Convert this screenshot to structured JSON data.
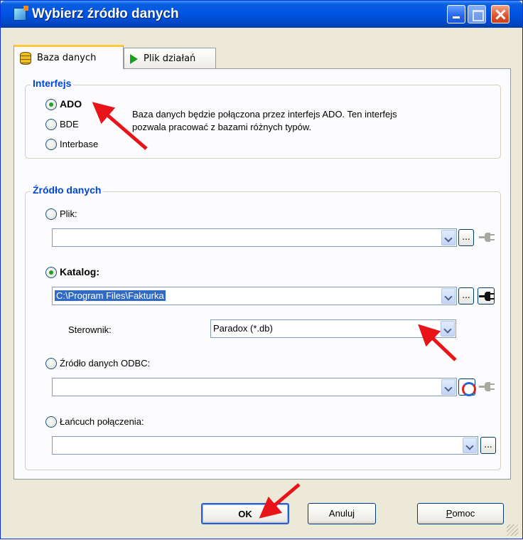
{
  "window": {
    "title": "Wybierz źródło danych",
    "controls": [
      "minimize-icon",
      "maximize-icon",
      "close-icon"
    ]
  },
  "tabs": [
    {
      "label": "Baza danych",
      "icon": "database-icon",
      "active": true
    },
    {
      "label": "Plik działań",
      "icon": "play-icon",
      "active": false
    }
  ],
  "interface_group": {
    "title": "Interfejs",
    "options": [
      {
        "label": "ADO",
        "checked": true
      },
      {
        "label": "BDE",
        "checked": false
      },
      {
        "label": "Interbase",
        "checked": false
      }
    ],
    "description_line1": "Baza danych będzie połączona przez interfejs ADO. Ten interfejs",
    "description_line2": "pozwala pracować z bazami różnych typów."
  },
  "source_group": {
    "title": "Źródło danych",
    "plik": {
      "label": "Plik:",
      "value": "",
      "browse": "..."
    },
    "katalog": {
      "label": "Katalog:",
      "value": "C:\\Program Files\\Fakturka",
      "browse": "..."
    },
    "sterownik": {
      "label": "Sterownik:",
      "value": "Paradox (*.db)"
    },
    "odbc": {
      "label": "Źródło danych ODBC:",
      "value": ""
    },
    "lancuch": {
      "label": "Łańcuch połączenia:",
      "value": "",
      "browse": "..."
    }
  },
  "buttons": {
    "ok": "OK",
    "cancel": "Anuluj",
    "help_p": "P",
    "help_rest": "omoc"
  },
  "colors": {
    "titlebar": "#0054e3",
    "group_title": "#0046d5",
    "annotation_arrow": "#e8141a"
  }
}
